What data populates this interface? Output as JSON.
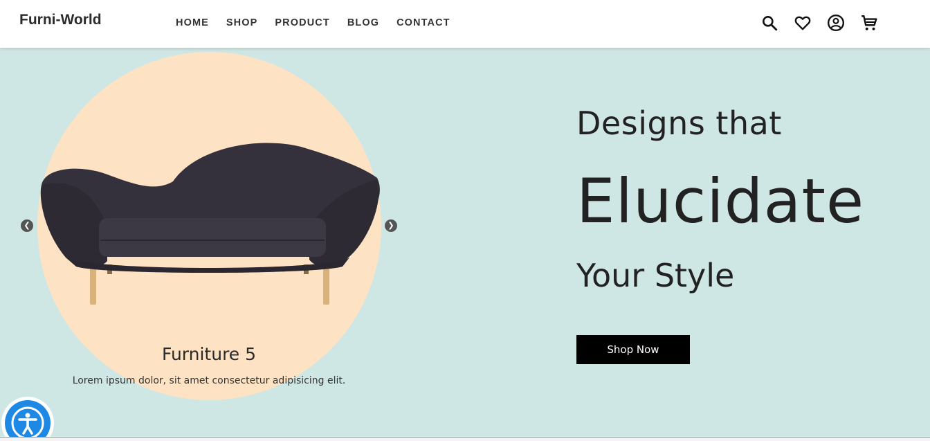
{
  "brand": "Furni-World",
  "nav": {
    "links": [
      "HOME",
      "SHOP",
      "PRODUCT",
      "BLOG",
      "CONTACT"
    ],
    "icons": [
      "search-icon",
      "heart-icon",
      "user-icon",
      "cart-icon"
    ]
  },
  "carousel": {
    "caption_title": "Furniture 5",
    "caption_text": "Lorem ipsum dolor, sit amet consectetur adipisicing elit."
  },
  "hero": {
    "line1": "Designs that",
    "line2": "Elucidate",
    "line3": "Your Style",
    "button": "Shop Now"
  },
  "colors": {
    "background": "#cfe7e4",
    "circle": "#fde2c4",
    "sofa": "#35313c",
    "accessibility": "#1e88e5"
  }
}
